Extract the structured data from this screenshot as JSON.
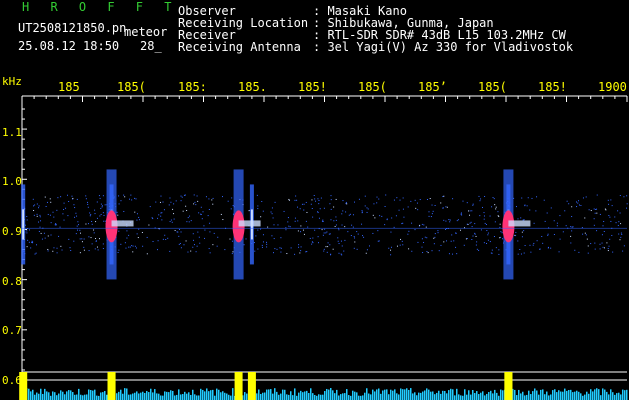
{
  "header": {
    "title": "H R O F F T",
    "filename": "UT2508121850.pn",
    "meteor_tag": "meteor",
    "datetime": "25.08.12 18:50",
    "count": "28_",
    "fields": [
      {
        "label": "Observer",
        "value": ": Masaki Kano"
      },
      {
        "label": "Receiving Location",
        "value": ": Shibukawa, Gunma, Japan"
      },
      {
        "label": "Receiver",
        "value": ": RTL-SDR SDR# 43dB L15 103.2MHz CW"
      },
      {
        "label": "Receiving Antenna",
        "value": ": 3el Yagi(V) Az 330 for Vladivostok"
      }
    ]
  },
  "axis": {
    "y_unit": "kHz",
    "y_ticks": [
      "1.1",
      "1.0",
      "0.9",
      "0.8",
      "0.7",
      "0.6"
    ],
    "x_ticks": [
      "185",
      "185(",
      "185:",
      "185.",
      "185!",
      "185(",
      "185’",
      "185(",
      "185!",
      "1900"
    ]
  },
  "colors": {
    "background": "#000000",
    "grid": "#ffffff",
    "label": "#ffff00",
    "title": "#33cc33",
    "signal_hot": "#ff3377",
    "signal_mid": "#3366ff",
    "signal_low": "#ccddff",
    "bar_yellow": "#ffff00",
    "bar_cyan": "#22ccff"
  },
  "chart_data": {
    "type": "heatmap",
    "x_range": [
      1850,
      1900
    ],
    "y_range_khz": [
      0.6,
      1.15
    ],
    "meteor_echoes_minutes": [
      1850.1,
      1857.4,
      1869.0,
      1890.2
    ],
    "strong_echoes_minutes": [
      1857.4,
      1867.9,
      1890.2
    ]
  }
}
